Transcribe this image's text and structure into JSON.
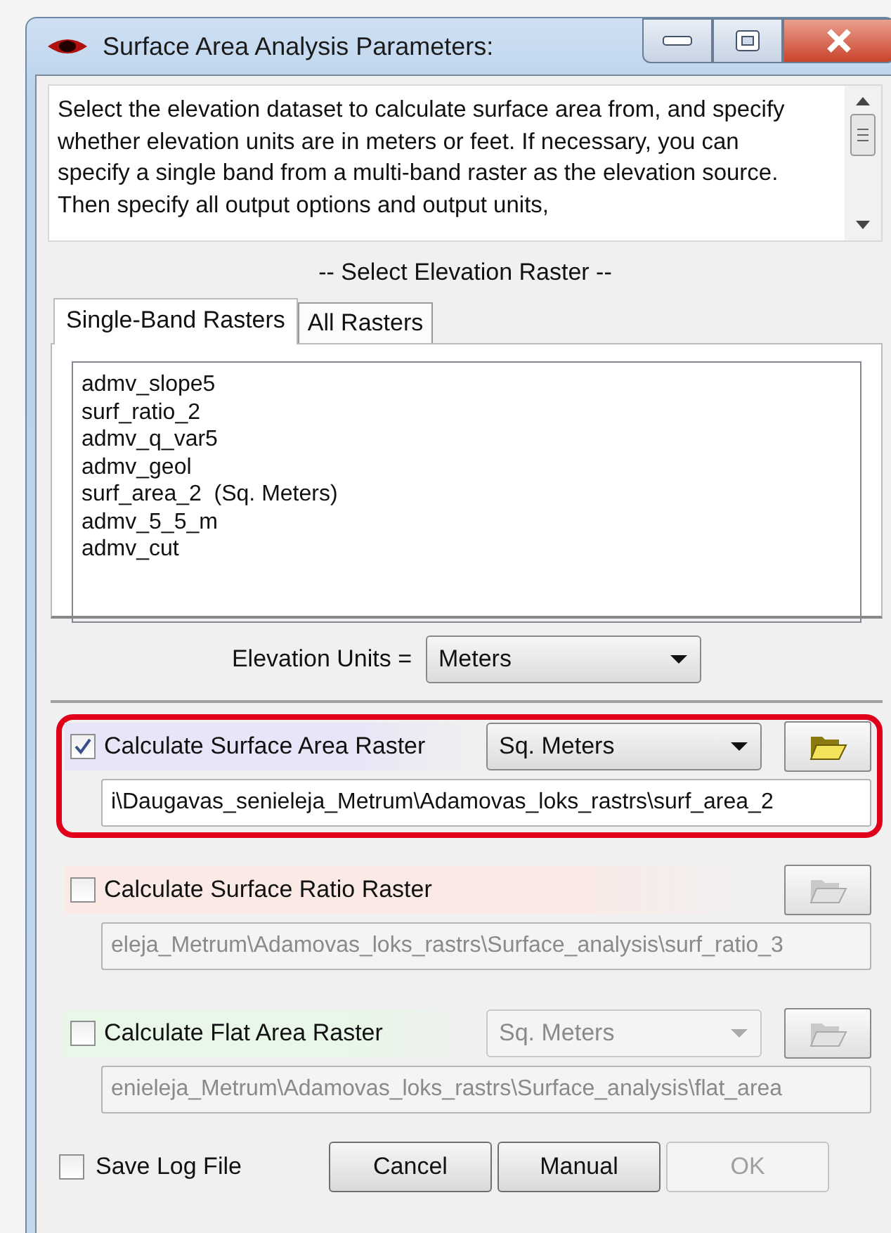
{
  "window": {
    "title": "Surface Area Analysis Parameters:"
  },
  "description": "Select the elevation dataset to calculate surface area from, and specify whether elevation units are in meters or feet. If necessary, you can specify a single band from a multi-band raster as the elevation source. Then specify all output options and output units,",
  "raster_heading": "-- Select Elevation Raster --",
  "tabs": [
    {
      "label": "Single-Band Rasters",
      "selected": true
    },
    {
      "label": "All Rasters",
      "selected": false
    }
  ],
  "rasters": [
    "admv_slope5",
    "surf_ratio_2",
    "admv_q_var5",
    "admv_geol",
    "surf_area_2  (Sq. Meters)",
    "admv_5_5_m",
    "admv_cut"
  ],
  "elevation_units": {
    "label": "Elevation Units =",
    "value": "Meters"
  },
  "outputs": [
    {
      "label": "Calculate Surface Area Raster",
      "checked": true,
      "highlighted": true,
      "color": "#e6e6f8",
      "units": {
        "value": "Sq. Meters",
        "disabled": false
      },
      "path": "i\\Daugavas_senieleja_Metrum\\Adamovas_loks_rastrs\\surf_area_2",
      "disabled": false
    },
    {
      "label": "Calculate Surface Ratio Raster",
      "checked": false,
      "highlighted": false,
      "color": "#fbe9e6",
      "path": "eleja_Metrum\\Adamovas_loks_rastrs\\Surface_analysis\\surf_ratio_3",
      "disabled": true
    },
    {
      "label": "Calculate Flat Area Raster",
      "checked": false,
      "highlighted": false,
      "color": "#e8f7e8",
      "units": {
        "value": "Sq. Meters",
        "disabled": true
      },
      "path": "enieleja_Metrum\\Adamovas_loks_rastrs\\Surface_analysis\\flat_area",
      "disabled": true
    }
  ],
  "save_log": {
    "label": "Save Log File",
    "checked": false
  },
  "buttons": [
    {
      "label": "Cancel",
      "disabled": false
    },
    {
      "label": "Manual",
      "disabled": false
    },
    {
      "label": "OK",
      "disabled": true
    }
  ]
}
